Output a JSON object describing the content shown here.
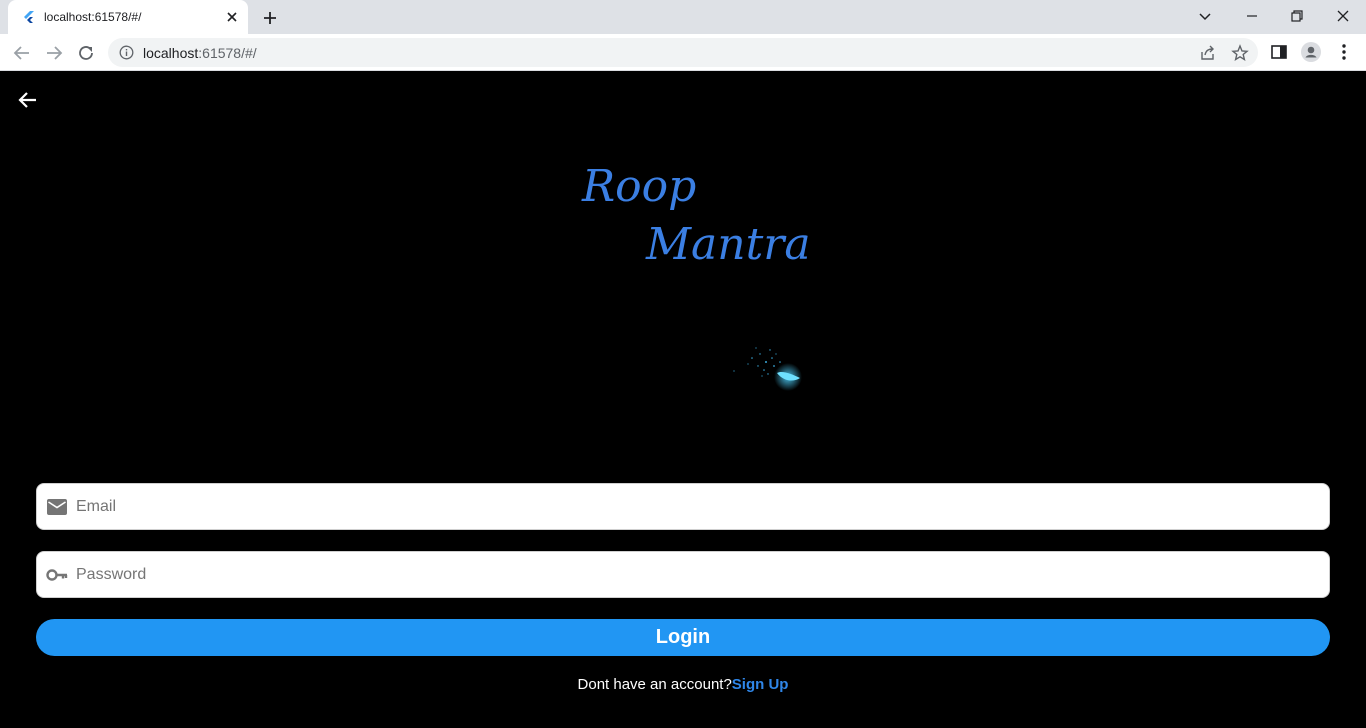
{
  "browser": {
    "tab_title": "localhost:61578/#/",
    "url_host": "localhost",
    "url_rest": ":61578/#/"
  },
  "app": {
    "brand_line1": "Roop",
    "brand_line2": "Mantra",
    "email_placeholder": "Email",
    "password_placeholder": "Password",
    "login_label": "Login",
    "signup_prompt": "Dont have an account?",
    "signup_link": "Sign Up"
  },
  "colors": {
    "brand": "#3b7fe3",
    "login_button": "#2196f3",
    "signup_link": "#2f86e8",
    "background": "#000000"
  }
}
